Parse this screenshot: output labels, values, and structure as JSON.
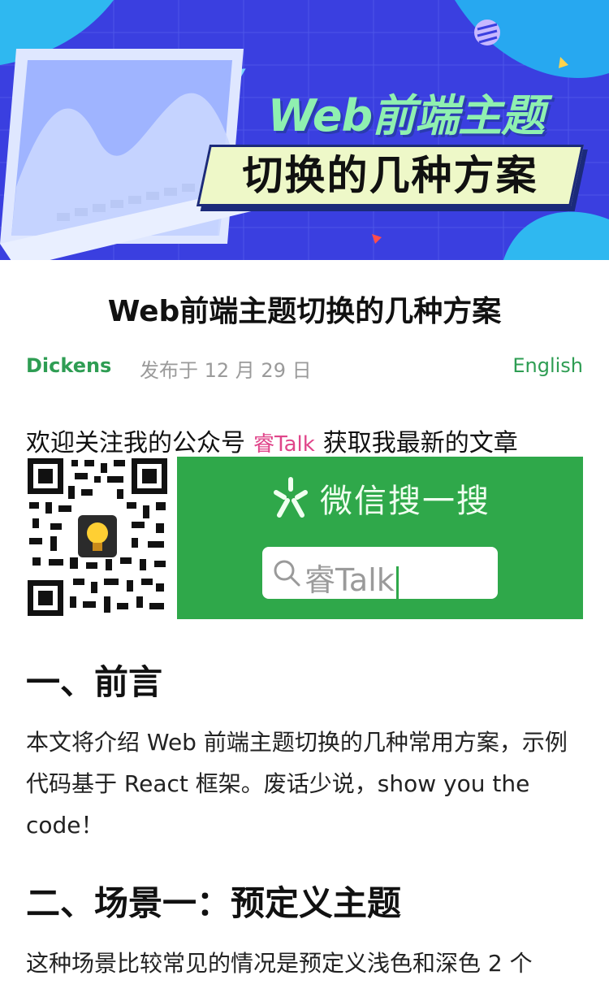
{
  "banner": {
    "line1": "Web前端主题",
    "line2": "切换的几种方案",
    "colors": {
      "bg": "#3a3fe0",
      "accent": "#8ff0b0"
    }
  },
  "article": {
    "title": "Web前端主题切换的几种方案",
    "author": "Dickens",
    "date": "发布于 12 月 29 日",
    "language_link": "English"
  },
  "promo": {
    "before": "欢迎关注我的公众号",
    "account": "睿Talk",
    "after": "获取我最新的文章",
    "wechat_label": "微信搜一搜",
    "search_query": "睿Talk",
    "qr_icon": "qr-code-icon"
  },
  "sections": [
    {
      "heading": "一、前言",
      "body": "本文将介绍 Web 前端主题切换的几种常用方案，示例代码基于 React 框架。废话少说，show you the code！"
    },
    {
      "heading": "二、场景一：预定义主题",
      "body": "这种场景比较常见的情况是预定义浅色和深色 2 个"
    }
  ]
}
